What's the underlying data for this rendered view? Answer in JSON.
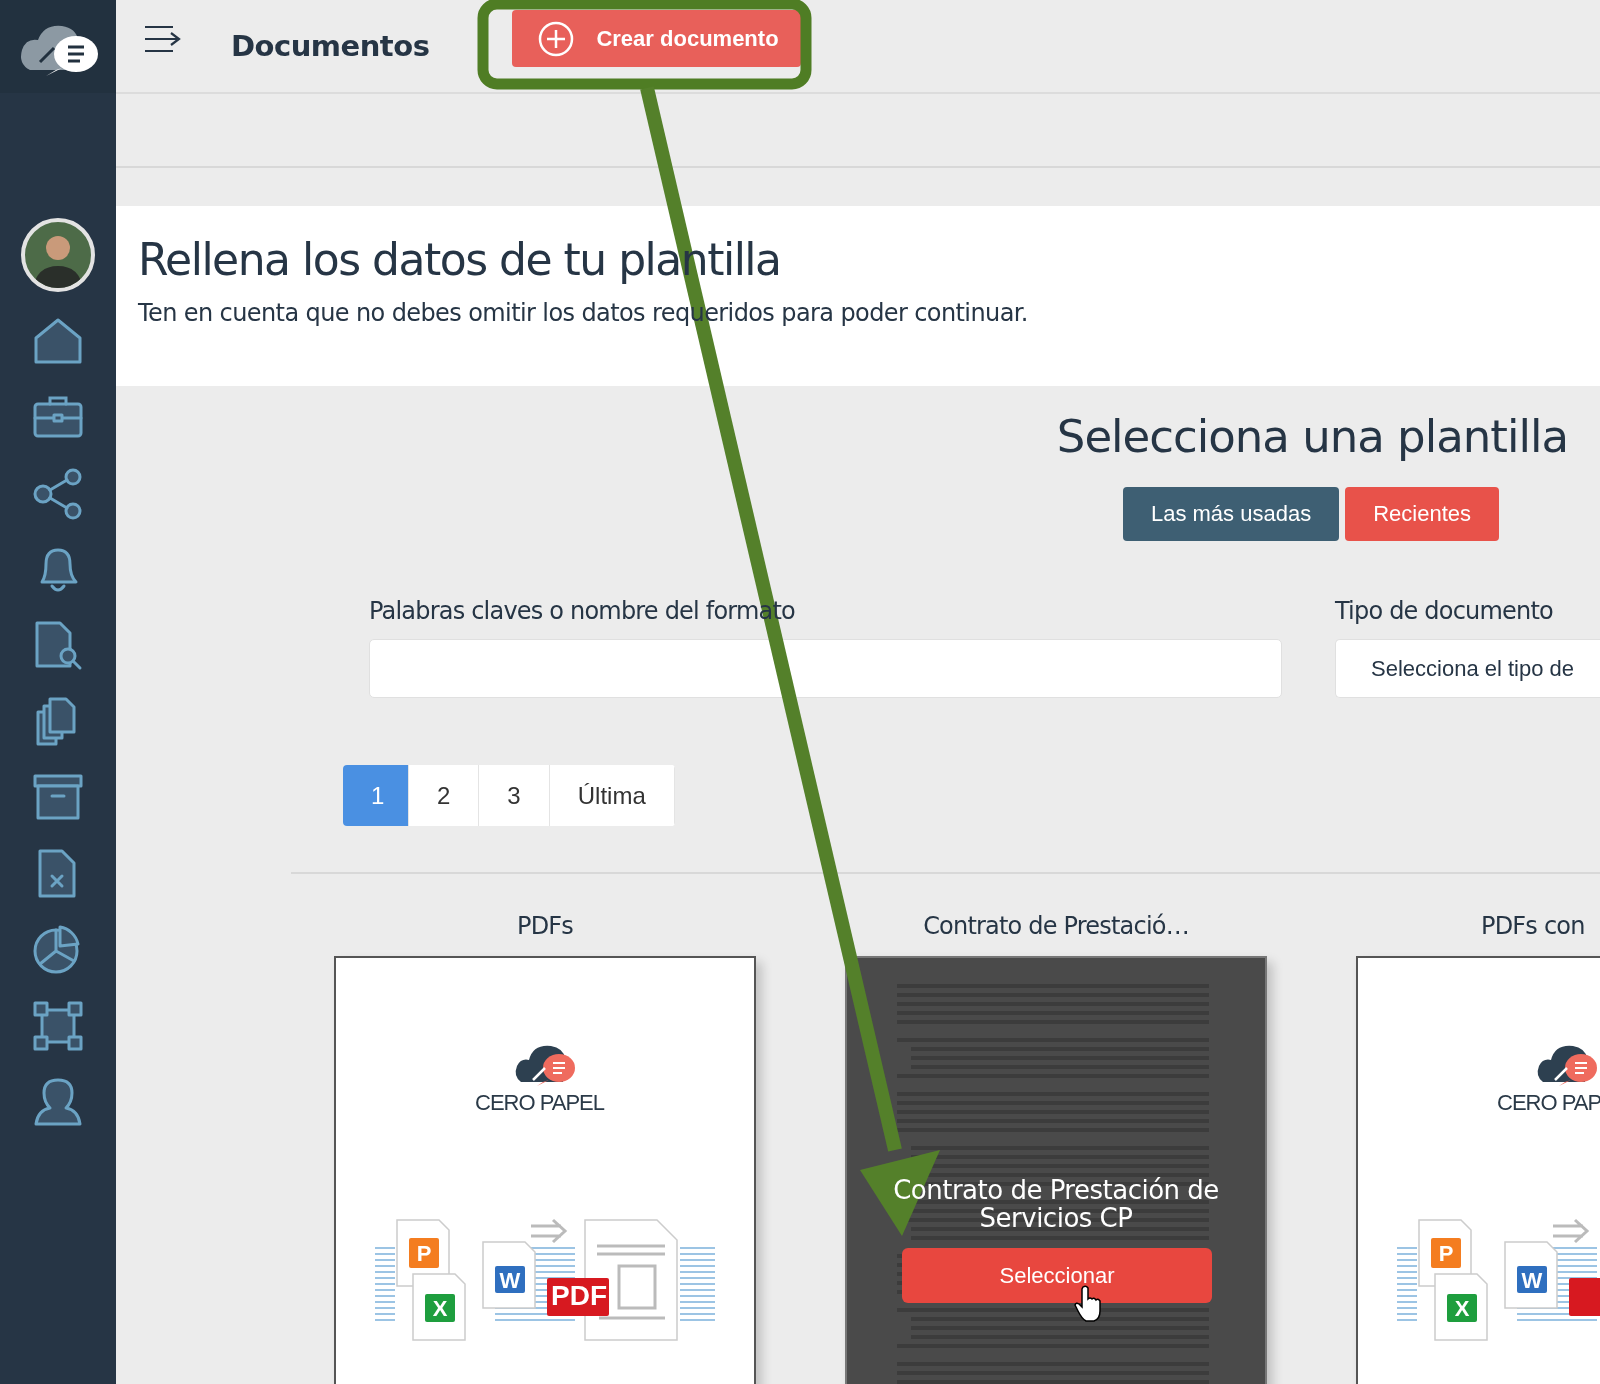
{
  "topbar": {
    "title": "Documentos",
    "create_button": "Crear documento"
  },
  "intro": {
    "title": "Rellena los datos de tu plantilla",
    "subtitle": "Ten en cuenta que no debes omitir los datos requeridos para poder continuar."
  },
  "templates": {
    "title": "Selecciona una plantilla",
    "filters": [
      {
        "label": "Las más usadas",
        "selected": false
      },
      {
        "label": "Recientes",
        "selected": true
      }
    ]
  },
  "search": {
    "label": "Palabras claves o nombre del formato"
  },
  "type_select": {
    "label": "Tipo de documento",
    "placeholder": "Selecciona el tipo de"
  },
  "pagination": [
    {
      "label": "1",
      "selected": true
    },
    {
      "label": "2",
      "selected": false
    },
    {
      "label": "3",
      "selected": false
    },
    {
      "label": "Última",
      "selected": false
    }
  ],
  "cards": [
    {
      "title": "PDFs",
      "kind": "logo",
      "brand": "CERO PAPEL",
      "badges": [
        {
          "text": "P",
          "color": "#f47d20"
        },
        {
          "text": "X",
          "color": "#1e9e3e"
        },
        {
          "text": "W",
          "color": "#2f6fbf"
        },
        {
          "text": "PDF",
          "color": "#d71920"
        }
      ]
    },
    {
      "title": "Contrato de Prestació…",
      "kind": "contract",
      "hovered": true,
      "overlay_title": "Contrato de Prestación de Servicios CP",
      "button": "Seleccionar"
    },
    {
      "title": "PDFs con",
      "kind": "logo",
      "brand": "CERO PAP",
      "badges": [
        {
          "text": "P",
          "color": "#f47d20"
        },
        {
          "text": "X",
          "color": "#1e9e3e"
        },
        {
          "text": "W",
          "color": "#2f6fbf"
        },
        {
          "color": "#d71920"
        }
      ]
    }
  ]
}
